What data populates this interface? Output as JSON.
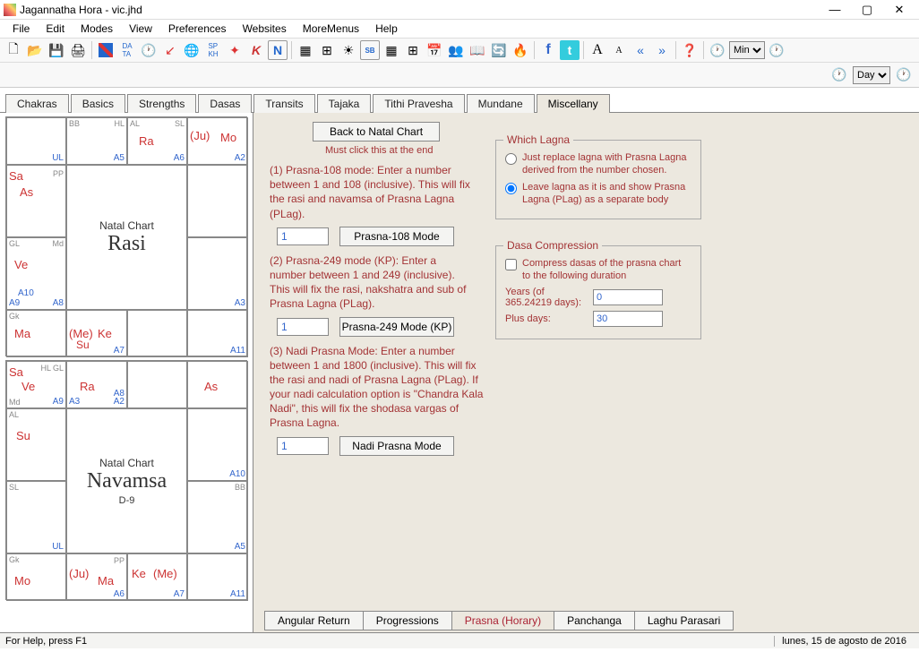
{
  "window": {
    "title": "Jagannatha Hora - vic.jhd"
  },
  "menu": [
    "File",
    "Edit",
    "Modes",
    "View",
    "Preferences",
    "Websites",
    "MoreMenus",
    "Help"
  ],
  "toolbar2": {
    "unit1": "Min",
    "unit2": "Day"
  },
  "topTabs": [
    "Chakras",
    "Basics",
    "Strengths",
    "Dasas",
    "Transits",
    "Tajaka",
    "Tithi Pravesha",
    "Mundane",
    "Miscellany"
  ],
  "topTabActive": "Miscellany",
  "chart1": {
    "centerTop": "Natal Chart",
    "centerMain": "Rasi",
    "centerSub": ""
  },
  "chart2": {
    "centerTop": "Natal Chart",
    "centerMain": "Navamsa",
    "centerSub": "D-9"
  },
  "right": {
    "backBtn": "Back to Natal Chart",
    "backNote": "Must click this at the end",
    "p108txt": "(1) Prasna-108 mode: Enter a number between 1 and 108 (inclusive). This will fix the rasi and navamsa of Prasna Lagna (PLag).",
    "p108in": "1",
    "p108btn": "Prasna-108 Mode",
    "p249txt": "(2) Prasna-249 mode (KP): Enter a number between 1 and 249 (inclusive). This will fix the rasi, nakshatra and sub of Prasna Lagna (PLag).",
    "p249in": "1",
    "p249btn": "Prasna-249 Mode (KP)",
    "naditxt": "(3) Nadi Prasna Mode: Enter a number between 1 and 1800 (inclusive). This will fix the rasi and nadi of Prasna Lagna (PLag). If your nadi calculation option is \"Chandra Kala Nadi\", this will fix the shodasa vargas of Prasna Lagna.",
    "nadiin": "1",
    "nadibtn": "Nadi Prasna Mode",
    "lagna": {
      "legend": "Which Lagna",
      "opt1": "Just replace lagna with Prasna Lagna derived from the number chosen.",
      "opt2": "Leave lagna as it is and show Prasna Lagna (PLag) as a separate body"
    },
    "dasa": {
      "legend": "Dasa Compression",
      "chk": "Compress dasas of the prasna chart to the following duration",
      "yearsLbl": "Years (of 365.24219 days):",
      "yearsVal": "0",
      "daysLbl": "Plus days:",
      "daysVal": "30"
    }
  },
  "bottomTabs": [
    "Angular Return",
    "Progressions",
    "Prasna (Horary)",
    "Panchanga",
    "Laghu Parasari"
  ],
  "bottomTabActive": "Prasna (Horary)",
  "status": {
    "left": "For Help, press F1",
    "right": "lunes, 15 de agosto de 2016"
  }
}
